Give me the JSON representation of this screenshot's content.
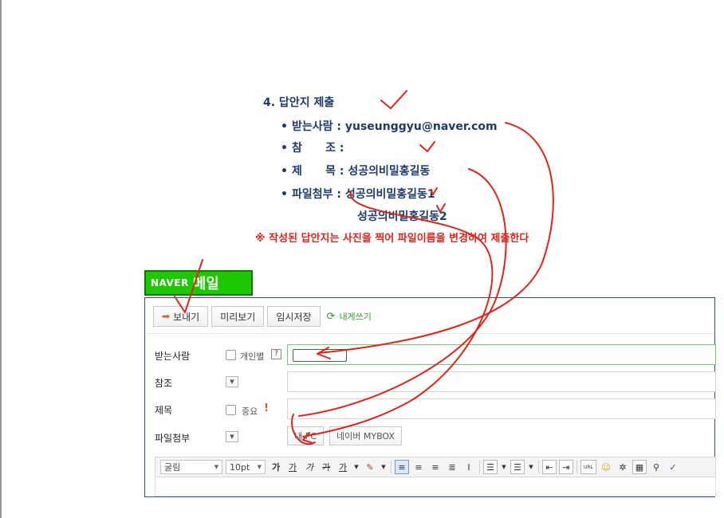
{
  "instructions": {
    "title": "4. 답안지 제출",
    "rows": [
      {
        "bullet": "•",
        "text": "받는사람 : yuseunggyu@naver.com"
      },
      {
        "bullet": "•",
        "text": "참      조 :"
      },
      {
        "bullet": "•",
        "text": "제      목 : 성공의비밀홍길동"
      },
      {
        "bullet": "•",
        "text": "파일첨부 : 성공의비밀홍길동1"
      },
      {
        "bullet": "",
        "text": "성공의비밀홍길동2"
      }
    ],
    "note": "※ 작성된 답안지는 사진을 찍어 파일이름을 변경하여 제출한다"
  },
  "logo": {
    "brand": "NAVER",
    "service": "메일"
  },
  "compose": {
    "send_label": "보내기",
    "preview_label": "미리보기",
    "save_draft_label": "임시저장",
    "self_write_label": "내게쓰기",
    "recipient_label": "받는사람",
    "individual_label": "개인별",
    "help_mark": "?",
    "cc_label": "참조",
    "subject_label": "제목",
    "important_label": "중요",
    "important_mark": "!",
    "attach_label": "파일첨부",
    "my_pc_label": "내 PC",
    "mybox_label": "네이버 MYBOX"
  },
  "editor": {
    "font": "굴림",
    "size": "10pt",
    "bold": "가",
    "underline": "가",
    "italic": "가",
    "strike": "가",
    "font_color": "가",
    "url": "URL"
  },
  "colors": {
    "naver_green": "#1ec800",
    "annotation_red": "#e1251b",
    "instruction_blue": "#1f3a6e"
  }
}
